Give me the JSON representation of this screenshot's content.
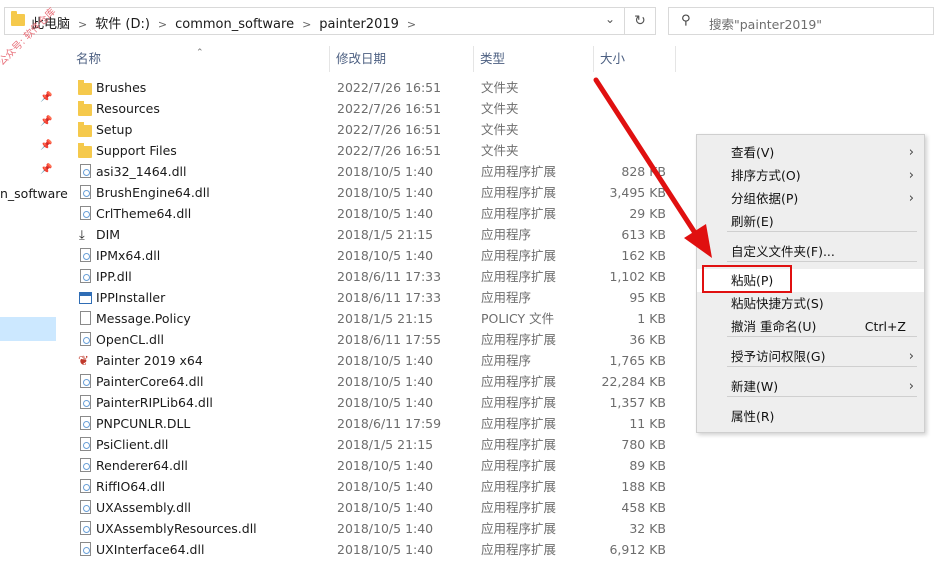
{
  "address_bar": {
    "breadcrumb": [
      "此电脑",
      "软件 (D:)",
      "common_software",
      "painter2019"
    ],
    "search_placeholder": "搜索\"painter2019\""
  },
  "nav_pane": {
    "truncated_item": "n_software"
  },
  "watermark": "公众号: 软件仓库",
  "columns": {
    "name": "名称",
    "date": "修改日期",
    "type": "类型",
    "size": "大小"
  },
  "files": [
    {
      "name": "Brushes",
      "date": "2022/7/26 16:51",
      "type": "文件夹",
      "size": "",
      "icon": "folder-icon"
    },
    {
      "name": "Resources",
      "date": "2022/7/26 16:51",
      "type": "文件夹",
      "size": "",
      "icon": "folder-icon"
    },
    {
      "name": "Setup",
      "date": "2022/7/26 16:51",
      "type": "文件夹",
      "size": "",
      "icon": "folder-icon"
    },
    {
      "name": "Support Files",
      "date": "2022/7/26 16:51",
      "type": "文件夹",
      "size": "",
      "icon": "folder-icon"
    },
    {
      "name": "asi32_1464.dll",
      "date": "2018/10/5 1:40",
      "type": "应用程序扩展",
      "size": "828 KB",
      "icon": "dll-icon"
    },
    {
      "name": "BrushEngine64.dll",
      "date": "2018/10/5 1:40",
      "type": "应用程序扩展",
      "size": "3,495 KB",
      "icon": "dll-icon"
    },
    {
      "name": "CrlTheme64.dll",
      "date": "2018/10/5 1:40",
      "type": "应用程序扩展",
      "size": "29 KB",
      "icon": "dll-icon"
    },
    {
      "name": "DIM",
      "date": "2018/1/5 21:15",
      "type": "应用程序",
      "size": "613 KB",
      "icon": "download-icon"
    },
    {
      "name": "IPMx64.dll",
      "date": "2018/10/5 1:40",
      "type": "应用程序扩展",
      "size": "162 KB",
      "icon": "dll-icon"
    },
    {
      "name": "IPP.dll",
      "date": "2018/6/11 17:33",
      "type": "应用程序扩展",
      "size": "1,102 KB",
      "icon": "dll-icon"
    },
    {
      "name": "IPPInstaller",
      "date": "2018/6/11 17:33",
      "type": "应用程序",
      "size": "95 KB",
      "icon": "exe-icon"
    },
    {
      "name": "Message.Policy",
      "date": "2018/1/5 21:15",
      "type": "POLICY 文件",
      "size": "1 KB",
      "icon": "file-icon"
    },
    {
      "name": "OpenCL.dll",
      "date": "2018/6/11 17:55",
      "type": "应用程序扩展",
      "size": "36 KB",
      "icon": "dll-icon"
    },
    {
      "name": "Painter 2019 x64",
      "date": "2018/10/5 1:40",
      "type": "应用程序",
      "size": "1,765 KB",
      "icon": "painter-app-icon"
    },
    {
      "name": "PainterCore64.dll",
      "date": "2018/10/5 1:40",
      "type": "应用程序扩展",
      "size": "22,284 KB",
      "icon": "dll-icon"
    },
    {
      "name": "PainterRIPLib64.dll",
      "date": "2018/10/5 1:40",
      "type": "应用程序扩展",
      "size": "1,357 KB",
      "icon": "dll-icon"
    },
    {
      "name": "PNPCUNLR.DLL",
      "date": "2018/6/11 17:59",
      "type": "应用程序扩展",
      "size": "11 KB",
      "icon": "dll-icon"
    },
    {
      "name": "PsiClient.dll",
      "date": "2018/1/5 21:15",
      "type": "应用程序扩展",
      "size": "780 KB",
      "icon": "dll-icon"
    },
    {
      "name": "Renderer64.dll",
      "date": "2018/10/5 1:40",
      "type": "应用程序扩展",
      "size": "89 KB",
      "icon": "dll-icon"
    },
    {
      "name": "RiffIO64.dll",
      "date": "2018/10/5 1:40",
      "type": "应用程序扩展",
      "size": "188 KB",
      "icon": "dll-icon"
    },
    {
      "name": "UXAssembly.dll",
      "date": "2018/10/5 1:40",
      "type": "应用程序扩展",
      "size": "458 KB",
      "icon": "dll-icon"
    },
    {
      "name": "UXAssemblyResources.dll",
      "date": "2018/10/5 1:40",
      "type": "应用程序扩展",
      "size": "32 KB",
      "icon": "dll-icon"
    },
    {
      "name": "UXInterface64.dll",
      "date": "2018/10/5 1:40",
      "type": "应用程序扩展",
      "size": "6,912 KB",
      "icon": "dll-icon"
    }
  ],
  "context_menu": {
    "items": [
      {
        "label": "查看(V)",
        "submenu": true
      },
      {
        "label": "排序方式(O)",
        "submenu": true
      },
      {
        "label": "分组依据(P)",
        "submenu": true
      },
      {
        "label": "刷新(E)"
      },
      {
        "label": "自定义文件夹(F)..."
      },
      {
        "label": "粘贴(P)",
        "highlighted": true
      },
      {
        "label": "粘贴快捷方式(S)"
      },
      {
        "label": "撤消 重命名(U)",
        "shortcut": "Ctrl+Z"
      },
      {
        "label": "授予访问权限(G)",
        "submenu": true
      },
      {
        "label": "新建(W)",
        "submenu": true
      },
      {
        "label": "属性(R)"
      }
    ]
  },
  "colors": {
    "annotation_red": "#e01010",
    "folder_yellow": "#f5c94c",
    "header_text": "#4d6082"
  }
}
